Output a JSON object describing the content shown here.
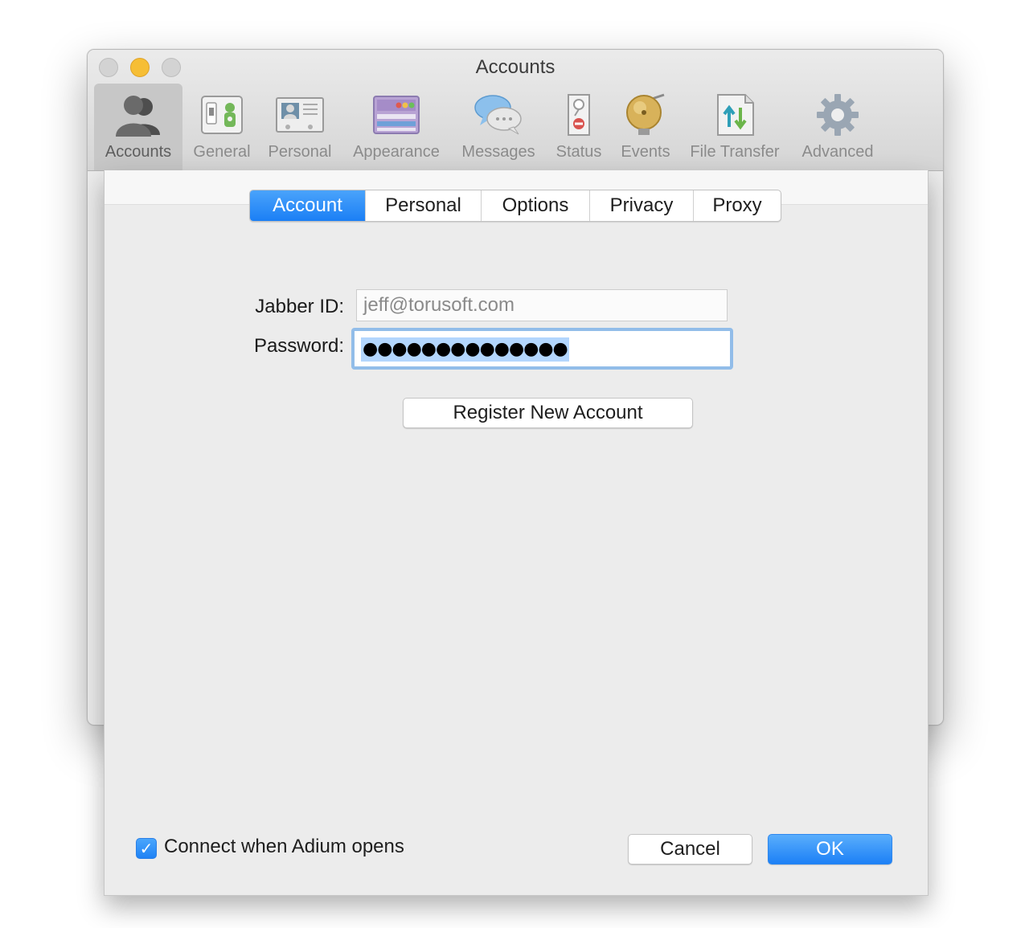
{
  "window": {
    "title": "Accounts",
    "toolbar": [
      {
        "label": "Accounts",
        "icon": "people-icon",
        "selected": true
      },
      {
        "label": "General",
        "icon": "light-switch-icon"
      },
      {
        "label": "Personal",
        "icon": "id-card-icon"
      },
      {
        "label": "Appearance",
        "icon": "appearance-window-icon"
      },
      {
        "label": "Messages",
        "icon": "speech-bubbles-icon"
      },
      {
        "label": "Status",
        "icon": "door-hanger-icon"
      },
      {
        "label": "Events",
        "icon": "bell-icon"
      },
      {
        "label": "File Transfer",
        "icon": "transfer-arrows-icon"
      },
      {
        "label": "Advanced",
        "icon": "gear-icon"
      }
    ]
  },
  "sheet": {
    "tabs": [
      {
        "label": "Account",
        "active": true
      },
      {
        "label": "Personal"
      },
      {
        "label": "Options"
      },
      {
        "label": "Privacy"
      },
      {
        "label": "Proxy"
      }
    ],
    "jabber_id": {
      "label": "Jabber ID:",
      "placeholder": "jeff@torusoft.com"
    },
    "password": {
      "label": "Password:",
      "value": "●●●●●●●●●●●●●●"
    },
    "register_label": "Register New Account",
    "connect_checkbox": {
      "label": "Connect when Adium opens",
      "checked": true,
      "mark": "✓"
    },
    "cancel_label": "Cancel",
    "ok_label": "OK"
  },
  "colors": {
    "accent": "#1b7ff5",
    "selection": "#b3d6fd",
    "focus_ring": "#92bde9"
  }
}
